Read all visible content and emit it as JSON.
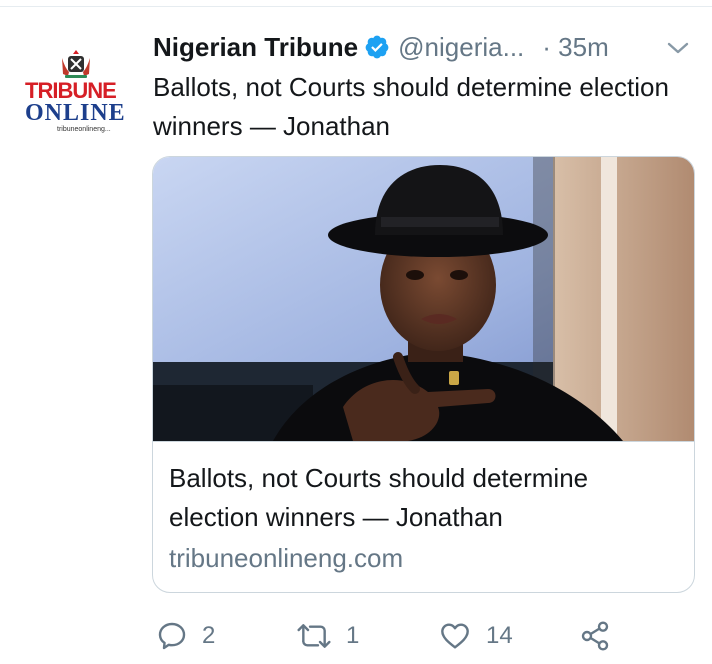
{
  "tweet": {
    "display_name": "Nigerian Tribune",
    "handle": "@nigeria...",
    "time": "· 35m",
    "text": "Ballots, not Courts should determine election winners — Jonathan"
  },
  "avatar": {
    "logo_line1": "TRIBUNE",
    "logo_line2": "ONLINE",
    "logo_line3": "tribuneonlineng..."
  },
  "card": {
    "title": "Ballots, not Courts should determine election winners — Jonathan",
    "domain": "tribuneonlineng.com"
  },
  "actions": {
    "reply_count": "2",
    "retweet_count": "1",
    "like_count": "14"
  },
  "icons": {
    "verified": "verified-badge-icon",
    "caret": "chevron-down-icon",
    "reply": "reply-icon",
    "retweet": "retweet-icon",
    "like": "heart-icon",
    "share": "share-icon"
  },
  "colors": {
    "accent": "#1da1f2",
    "text": "#14171a",
    "secondary": "#657786",
    "border": "#ccd6dd"
  }
}
